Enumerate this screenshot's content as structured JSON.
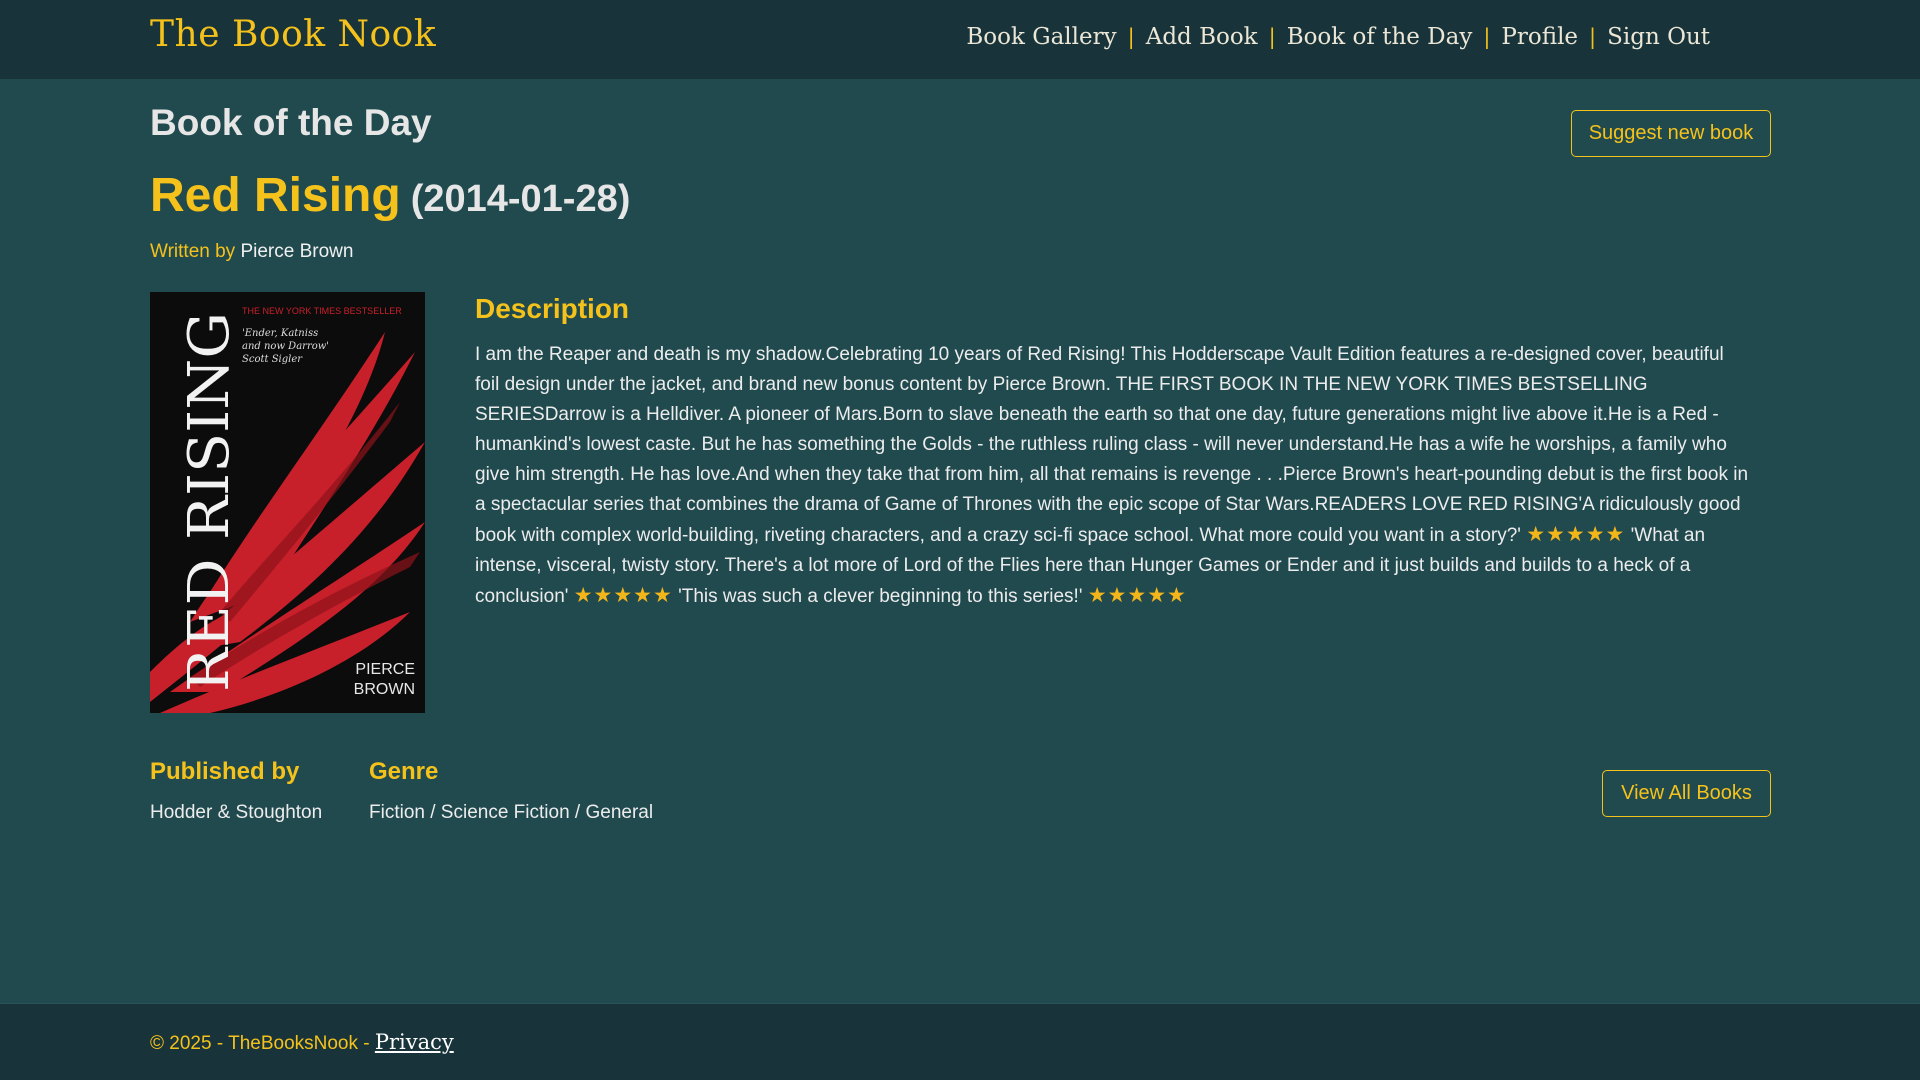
{
  "header": {
    "brand": "The Book Nook",
    "nav": [
      {
        "label": "Book Gallery"
      },
      {
        "label": "Add Book"
      },
      {
        "label": "Book of the Day"
      },
      {
        "label": "Profile"
      },
      {
        "label": "Sign Out"
      }
    ],
    "separator": "|"
  },
  "page": {
    "heading": "Book of the Day",
    "suggest_button": "Suggest new book",
    "view_all_button": "View All Books"
  },
  "book": {
    "title": "Red Rising",
    "date": "(2014-01-28)",
    "written_by_label": "Written by",
    "author": "Pierce Brown",
    "cover": {
      "tagline": "THE NEW YORK TIMES BESTSELLER",
      "quote_line1": "'Ender, Katniss",
      "quote_line2": "and now Darrow'",
      "quote_source": "Scott Sigler",
      "title_text": "RED RISING",
      "author_line1": "PIERCE",
      "author_line2": "BROWN"
    },
    "description_heading": "Description",
    "description_parts": [
      "I am the Reaper and death is my shadow.Celebrating 10 years of Red Rising! This Hodderscape Vault Edition features a re-designed cover, beautiful foil design under the jacket, and brand new bonus content by Pierce Brown. THE FIRST BOOK IN THE NEW YORK TIMES BESTSELLING SERIESDarrow is a Helldiver. A pioneer of Mars.Born to slave beneath the earth so that one day, future generations might live above it.He is a Red - humankind's lowest caste. But he has something the Golds - the ruthless ruling class - will never understand.He has a wife he worships, a family who give him strength. He has love.And when they take that from him, all that remains is revenge . . .Pierce Brown's heart-pounding debut is the first book in a spectacular series that combines the drama of Game of Thrones with the epic scope of Star Wars.READERS LOVE RED RISING'A ridiculously good book with complex world-building, riveting characters, and a crazy sci-fi space school. What more could you want in a story?'",
      "'What an intense, visceral, twisty story. There's a lot more of Lord of the Flies here than Hunger Games or Ender and it just builds and builds to a heck of a conclusion'",
      "'This was such a clever beginning to this series!'"
    ],
    "stars": "★★★★★",
    "published_by_label": "Published by",
    "publisher": "Hodder & Stoughton",
    "genre_label": "Genre",
    "genre": "Fiction / Science Fiction / General"
  },
  "footer": {
    "text": "© 2025 - TheBooksNook - ",
    "privacy": "Privacy"
  },
  "colors": {
    "background": "#214a4f",
    "navbar": "#18343a",
    "accent": "#f5c21b",
    "star": "#f2b51a",
    "cover_red": "#c8202a"
  }
}
